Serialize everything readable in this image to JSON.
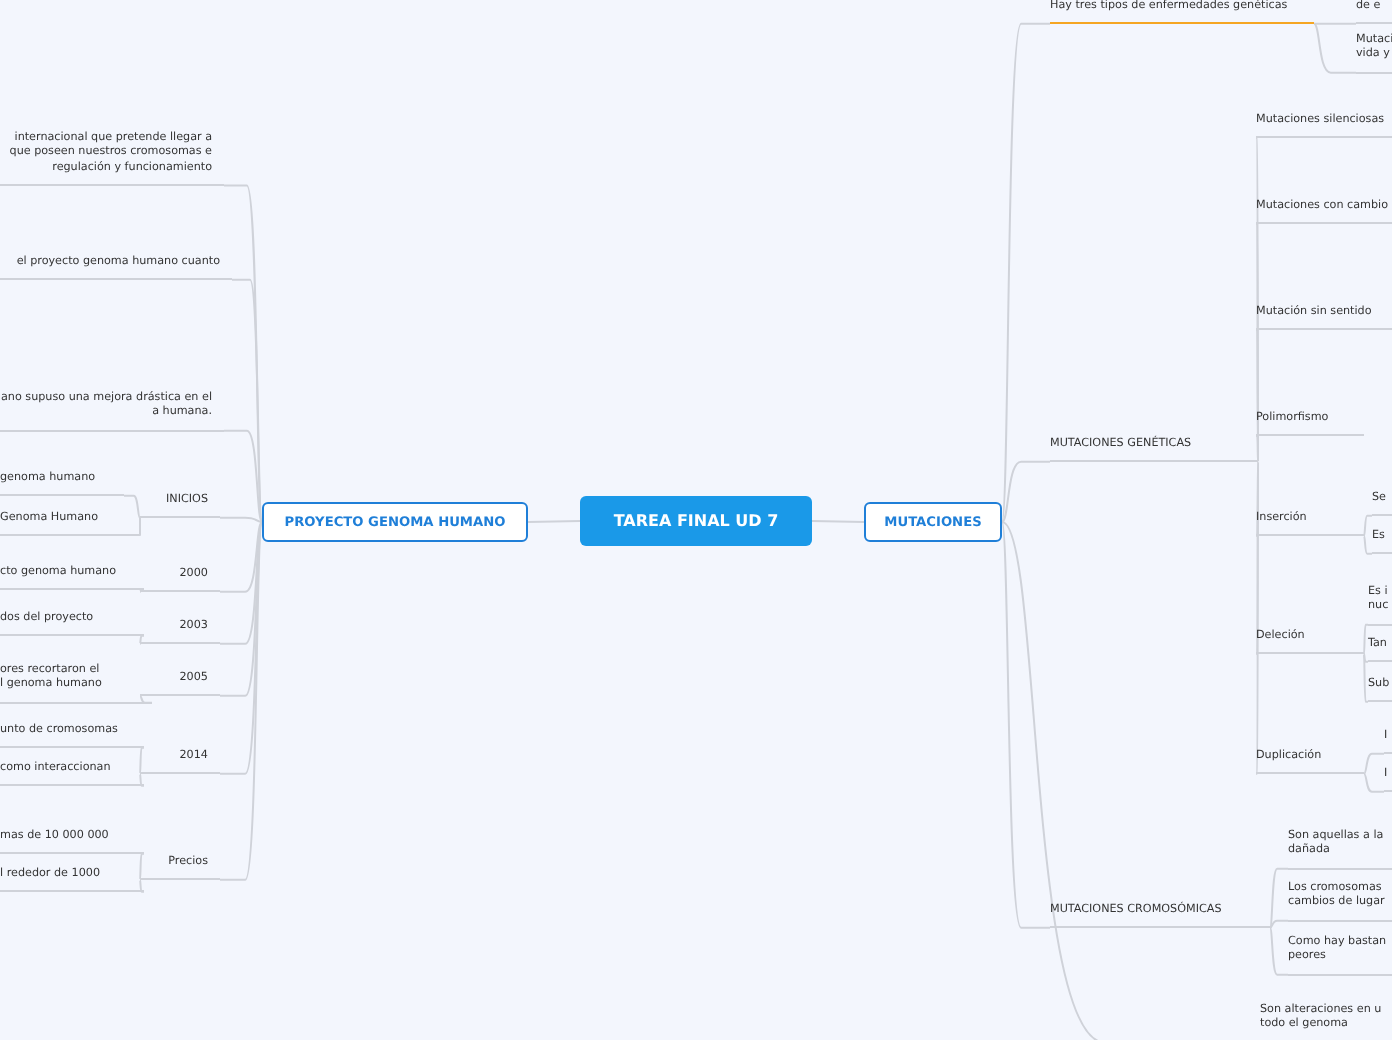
{
  "root": {
    "title": "TAREA FINAL UD 7"
  },
  "branches": [
    {
      "title": "PROYECTO GENOMA HUMANO",
      "children": [
        {
          "text": "internacional que pretende llegar a\nque poseen nuestros cromosomas e\nregulación y funcionamiento"
        },
        {
          "text": "el proyecto genoma humano cuanto"
        },
        {
          "text": "ano supuso una mejora drástica en el\na humana."
        },
        {
          "text": "INICIOS",
          "children": [
            {
              "text": "genoma humano"
            },
            {
              "text": "Genoma Humano"
            }
          ]
        },
        {
          "text": "2000",
          "children": [
            {
              "text": "cto genoma humano"
            }
          ]
        },
        {
          "text": "2003",
          "children": [
            {
              "text": "dos del proyecto"
            }
          ]
        },
        {
          "text": "2005",
          "children": [
            {
              "text": "ores recortaron el\nl genoma humano"
            }
          ]
        },
        {
          "text": "2014",
          "children": [
            {
              "text": "unto de cromosomas"
            },
            {
              "text": "como interaccionan"
            }
          ]
        },
        {
          "text": "Precios",
          "children": [
            {
              "text": "mas de 10 000 000"
            },
            {
              "text": "l rededor de 1000"
            }
          ]
        }
      ]
    },
    {
      "title": "MUTACIONES",
      "children": [
        {
          "text": "Hay tres tipos de enfermedades genéticas",
          "color": "#f5a623",
          "children": [
            {
              "text": "de e"
            },
            {
              "text": "Mutaci\nvida y"
            }
          ]
        },
        {
          "text": "MUTACIONES GENÉTICAS",
          "children": [
            {
              "text": "Mutaciones silenciosas"
            },
            {
              "text": "Mutaciones con cambio"
            },
            {
              "text": "Mutación sin sentido"
            },
            {
              "text": "Polimorfismo"
            },
            {
              "text": "Inserción",
              "children": [
                {
                  "text": "Se"
                },
                {
                  "text": "Es"
                }
              ]
            },
            {
              "text": "Deleción",
              "children": [
                {
                  "text": "Es i\nnuc"
                },
                {
                  "text": "Tan"
                },
                {
                  "text": "Sub"
                }
              ]
            },
            {
              "text": "Duplicación",
              "children": [
                {
                  "text": "I"
                },
                {
                  "text": "I"
                }
              ]
            }
          ]
        },
        {
          "text": "MUTACIONES CROMOSÓMICAS",
          "children": [
            {
              "text": "Son aquellas a la\ndañada"
            },
            {
              "text": "Los cromosomas\ncambios de lugar"
            },
            {
              "text": "Como hay bastan\npeores"
            }
          ]
        },
        {
          "children": [
            {
              "text": "Son alteraciones en u\ntodo el genoma"
            }
          ]
        }
      ]
    }
  ]
}
